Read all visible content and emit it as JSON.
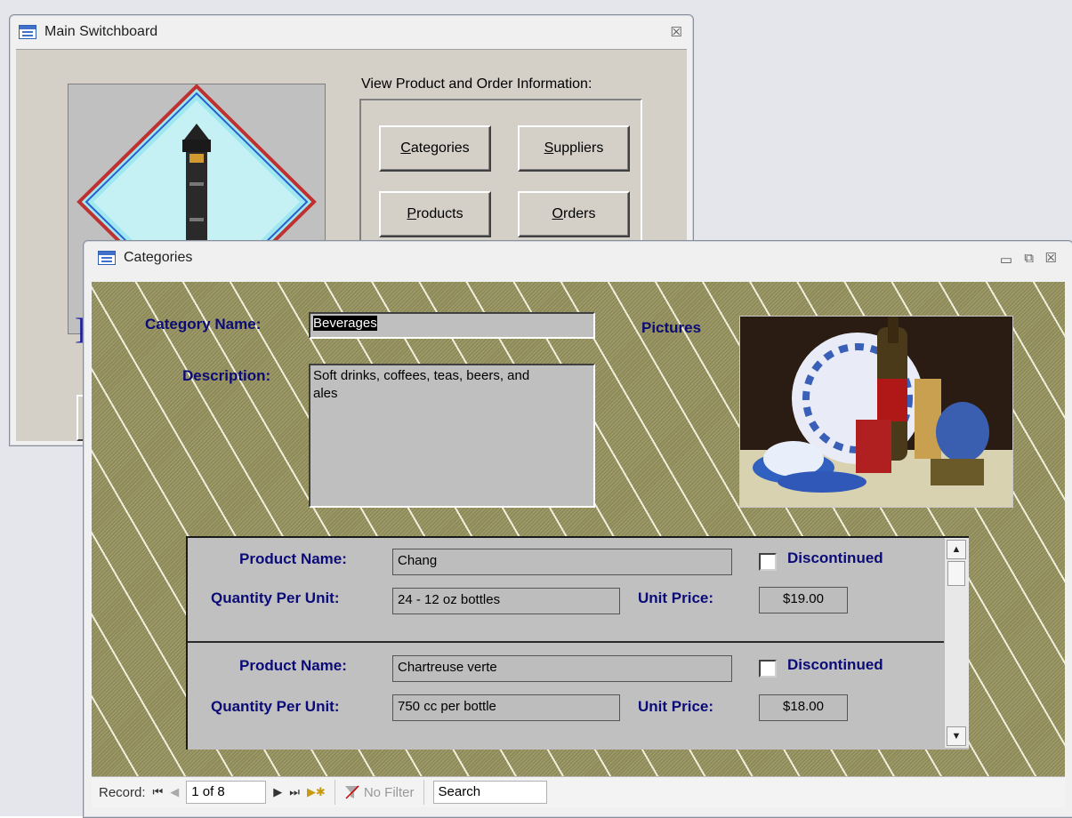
{
  "switchboard": {
    "title": "Main Switchboard",
    "close_glyph": "☒",
    "group_label": "View Product and Order Information:",
    "buttons": [
      {
        "label": "Categories",
        "accel": "C",
        "rest": "ategories"
      },
      {
        "label": "Suppliers",
        "accel": "S",
        "rest": "uppliers"
      },
      {
        "label": "Products",
        "accel": "P",
        "rest": "roducts"
      },
      {
        "label": "Orders",
        "accel": "O",
        "rest": "rders"
      }
    ]
  },
  "categories": {
    "title": "Categories",
    "window_buttons": {
      "minimize": "▭",
      "restore": "⧉",
      "close": "☒"
    },
    "fields": {
      "category_name_label": "Category Name:",
      "category_name_value": "Beverages",
      "description_label": "Description:",
      "description_value": "Soft drinks, coffees, teas, beers, and ales",
      "pictures_label": "Pictures"
    },
    "products": [
      {
        "product_name_label": "Product Name:",
        "product_name": "Chang",
        "discontinued_label": "Discontinued",
        "discontinued": false,
        "qty_label": "Quantity Per Unit:",
        "qty": "24 - 12 oz bottles",
        "price_label": "Unit Price:",
        "price": "$19.00"
      },
      {
        "product_name_label": "Product Name:",
        "product_name": "Chartreuse verte",
        "discontinued_label": "Discontinued",
        "discontinued": false,
        "qty_label": "Quantity Per Unit:",
        "qty": "750 cc per bottle",
        "price_label": "Unit Price:",
        "price": "$18.00"
      }
    ],
    "navigation": {
      "record_label": "Record:",
      "first_glyph": "⏮",
      "prev_glyph": "◀",
      "position": "1 of 8",
      "next_glyph": "▶",
      "last_glyph": "⏭",
      "new_glyph": "▶✱",
      "filter_label": "No Filter",
      "search_placeholder": "Search"
    }
  },
  "colors": {
    "form_background": "#8e8a58",
    "label_text": "#0b0b78",
    "switchboard_background": "#d4d0c8"
  }
}
